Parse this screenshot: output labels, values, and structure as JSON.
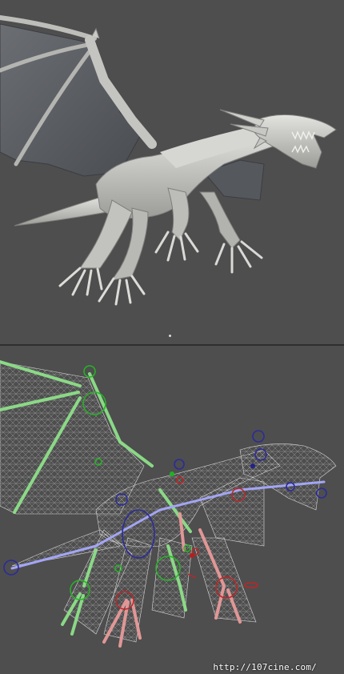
{
  "viewports": {
    "top": {
      "label": ""
    },
    "bottom": {
      "label": ""
    }
  },
  "watermark": "http://107cine.com/",
  "colors": {
    "background": "#4e4e4e",
    "model": "#c9c9c6",
    "wing_membrane": "#5c5f63",
    "wire": "#d8d8d8",
    "bones_green": "#7ed87a",
    "bones_red": "#e58c8c",
    "bones_blue": "#9a9cf0",
    "controls_green": "#1fb31f",
    "controls_red": "#b31f1f",
    "controls_blue": "#22228c"
  }
}
